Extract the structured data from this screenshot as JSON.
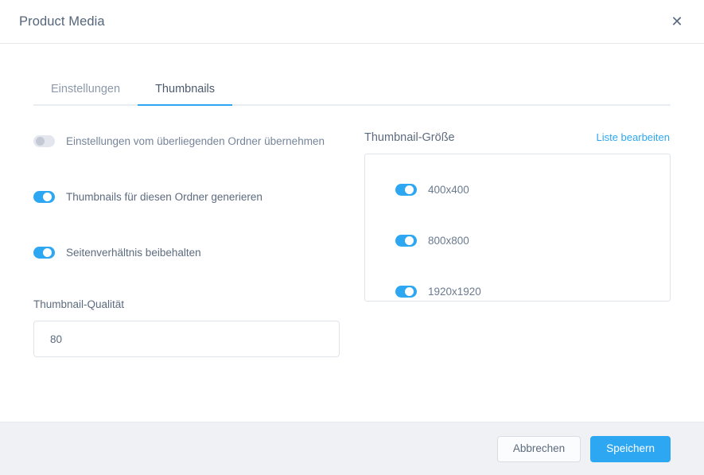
{
  "header": {
    "title": "Product Media",
    "close_icon": "close-icon",
    "close_glyph": "✕"
  },
  "tabs": [
    {
      "label": "Einstellungen",
      "active": false
    },
    {
      "label": "Thumbnails",
      "active": true
    }
  ],
  "settings": {
    "toggles": [
      {
        "label": "Einstellungen vom überliegenden Ordner übernehmen",
        "on": false
      },
      {
        "label": "Thumbnails für diesen Ordner generieren",
        "on": true
      },
      {
        "label": "Seitenverhältnis beibehalten",
        "on": true
      }
    ],
    "quality": {
      "label": "Thumbnail-Qualität",
      "value": "80",
      "placeholder": "80"
    }
  },
  "thumbnail_sizes": {
    "title": "Thumbnail-Größe",
    "edit_link": "Liste bearbeiten",
    "items": [
      {
        "label": "400x400",
        "on": true
      },
      {
        "label": "800x800",
        "on": true
      },
      {
        "label": "1920x1920",
        "on": true
      }
    ]
  },
  "footer": {
    "cancel_label": "Abbrechen",
    "save_label": "Speichern"
  },
  "colors": {
    "accent": "#2ea7f2",
    "text": "#5d6b7e",
    "footer_bg": "#f0f1f5",
    "border": "#dfe3ea"
  }
}
